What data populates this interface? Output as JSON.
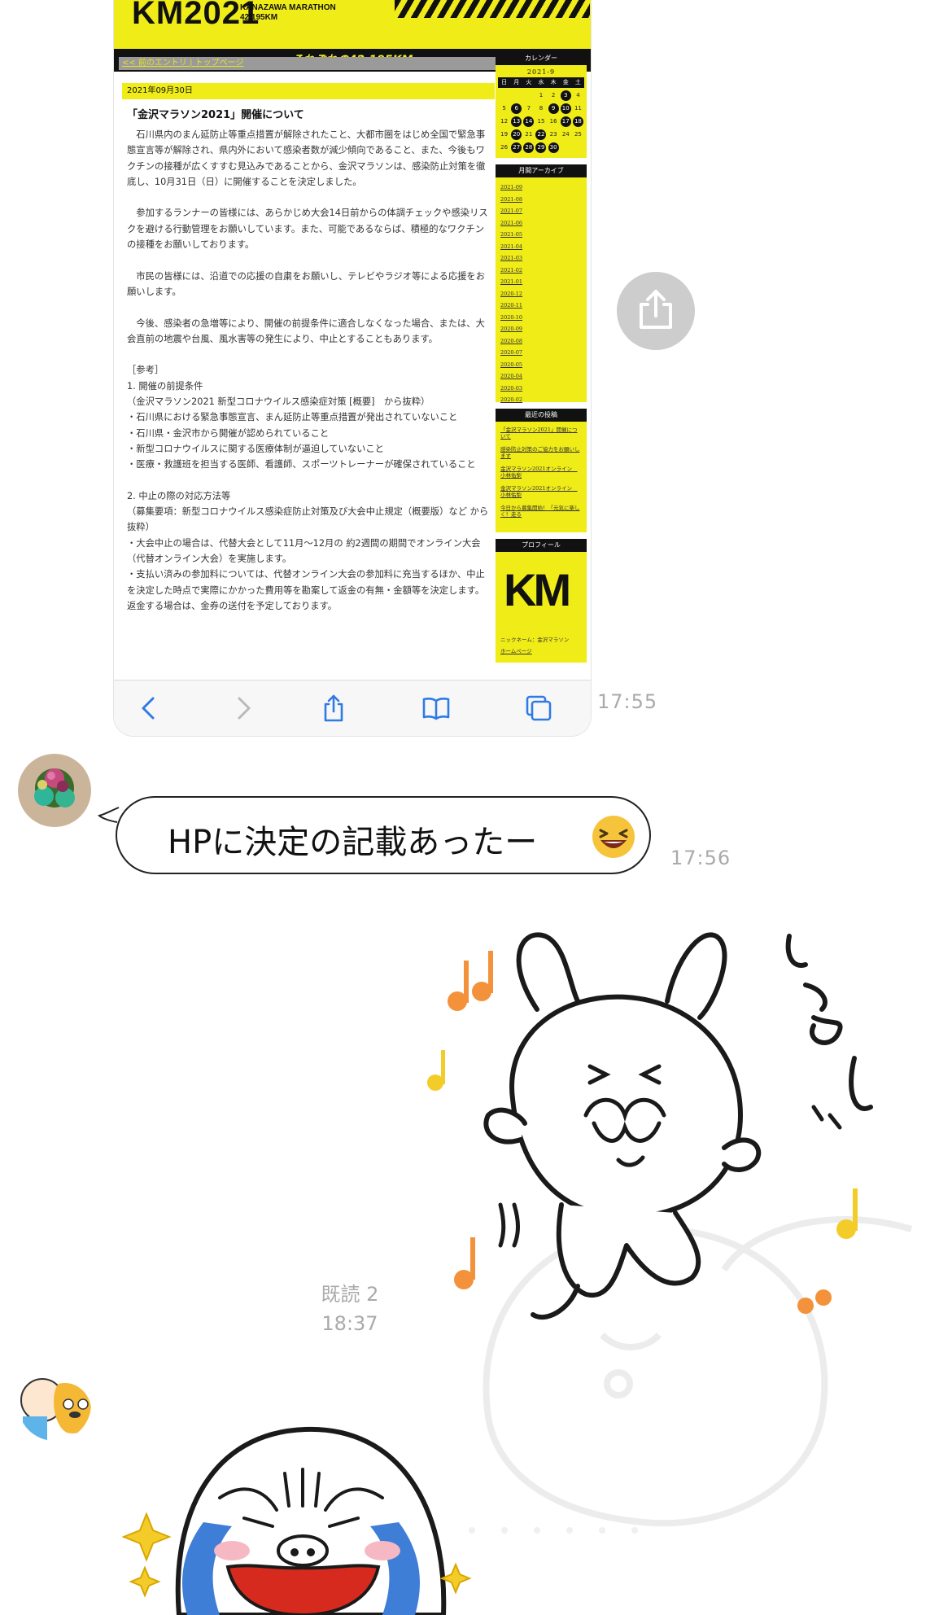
{
  "screenshot": {
    "header": {
      "logo": "KM2021",
      "logo_sub_line1": "KANAZAWA MARATHON",
      "logo_sub_line2": "42.195KM",
      "tagline": "それぞれの42.195KM"
    },
    "breadcrumb": "<< 前のエントリ | トップページ",
    "post": {
      "date": "2021年09月30日",
      "title": "「金沢マラソン2021」開催について",
      "body": "　石川県内のまん延防止等重点措置が解除されたこと、大都市圏をはじめ全国で緊急事態宣言等が解除され、県内外において感染者数が減少傾向であること、また、今後もワクチンの接種が広くすすむ見込みであることから、金沢マラソンは、感染防止対策を徹底し、10月31日（日）に開催することを決定しました。\n\n　参加するランナーの皆様には、あらかじめ大会14日前からの体調チェックや感染リスクを避ける行動管理をお願いしています。また、可能であるならば、積極的なワクチンの接種をお願いしております。\n\n　市民の皆様には、沿道での応援の自粛をお願いし、テレビやラジオ等による応援をお願いします。\n\n　今後、感染者の急増等により、開催の前提条件に適合しなくなった場合、または、大会直前の地震や台風、風水害等の発生により、中止とすることもあります。\n\n［参考］\n1. 開催の前提条件\n（金沢マラソン2021 新型コロナウイルス感染症対策 [概要]　から抜粋）\n・石川県における緊急事態宣言、まん延防止等重点措置が発出されていないこと\n・石川県・金沢市から開催が認められていること\n・新型コロナウイルスに関する医療体制が逼迫していないこと\n・医療・救護班を担当する医師、看護師、スポーツトレーナーが確保されていること\n\n2. 中止の際の対応方法等\n（募集要項：新型コロナウイルス感染症防止対策及び大会中止規定（概要版）など から抜粋）\n・大会中止の場合は、代替大会として11月～12月の 約2週間の期間でオンライン大会 （代替オンライン大会）を実施します。\n・支払い済みの参加料については、代替オンライン大会の参加料に充当するほか、中止を決定した時点で実際にかかった費用等を勘案して返金の有無・金額等を決定します。返金する場合は、金券の送付を予定しております。"
    },
    "sidebar": {
      "calendar_title": "カレンダー",
      "calendar_month": "2021-9",
      "weekdays": [
        "日",
        "月",
        "火",
        "水",
        "木",
        "金",
        "土"
      ],
      "archive_title": "月間アーカイブ",
      "archive": [
        "2021-09",
        "2021-08",
        "2021-07",
        "2021-06",
        "2021-05",
        "2021-04",
        "2021-03",
        "2021-02",
        "2021-01",
        "2020-12",
        "2020-11",
        "2020-10",
        "2020-09",
        "2020-08",
        "2020-07",
        "2020-05",
        "2020-04",
        "2020-03",
        "2020-02"
      ],
      "recent_title": "最近の投稿",
      "recent": [
        "「金沢マラソン2021」開催について",
        "感染防止対策のご協力をお願いします",
        "金沢マラソン2021オンライン　小林佑梨",
        "金沢マラソン2021オンライン　小林佑梨",
        "今日から募集開始！「元気に楽しく！走る"
      ],
      "profile_title": "プロフィール",
      "profile_logo": "KM",
      "profile_nick": "ニックネーム：金沢マラソン",
      "profile_home": "ホームページ"
    },
    "time": "17:55"
  },
  "message1": {
    "text": "HPに決定の記載あったー",
    "time": "17:56"
  },
  "sticker1": {
    "read_label": "既読 2",
    "time": "18:37"
  }
}
